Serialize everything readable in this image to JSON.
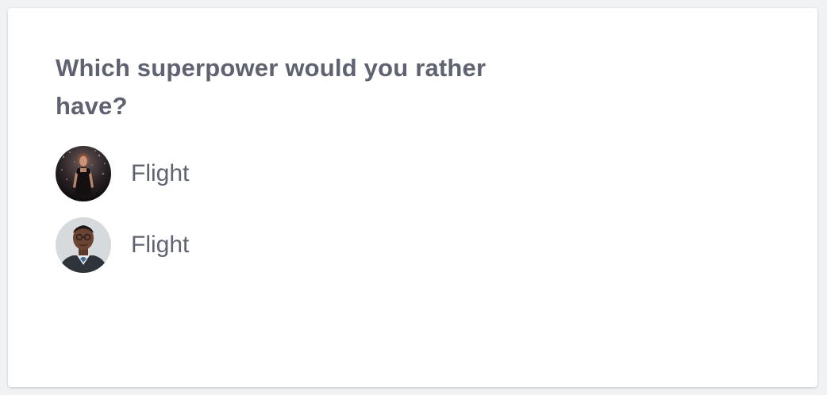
{
  "poll": {
    "question": "Which superpower would you rather have?",
    "answers": [
      {
        "text": "Flight",
        "avatar": "woman-portrait-avatar"
      },
      {
        "text": "Flight",
        "avatar": "man-portrait-avatar"
      }
    ]
  },
  "colors": {
    "text": "#5f6270",
    "card_background": "#ffffff",
    "page_background": "#f1f2f4"
  }
}
